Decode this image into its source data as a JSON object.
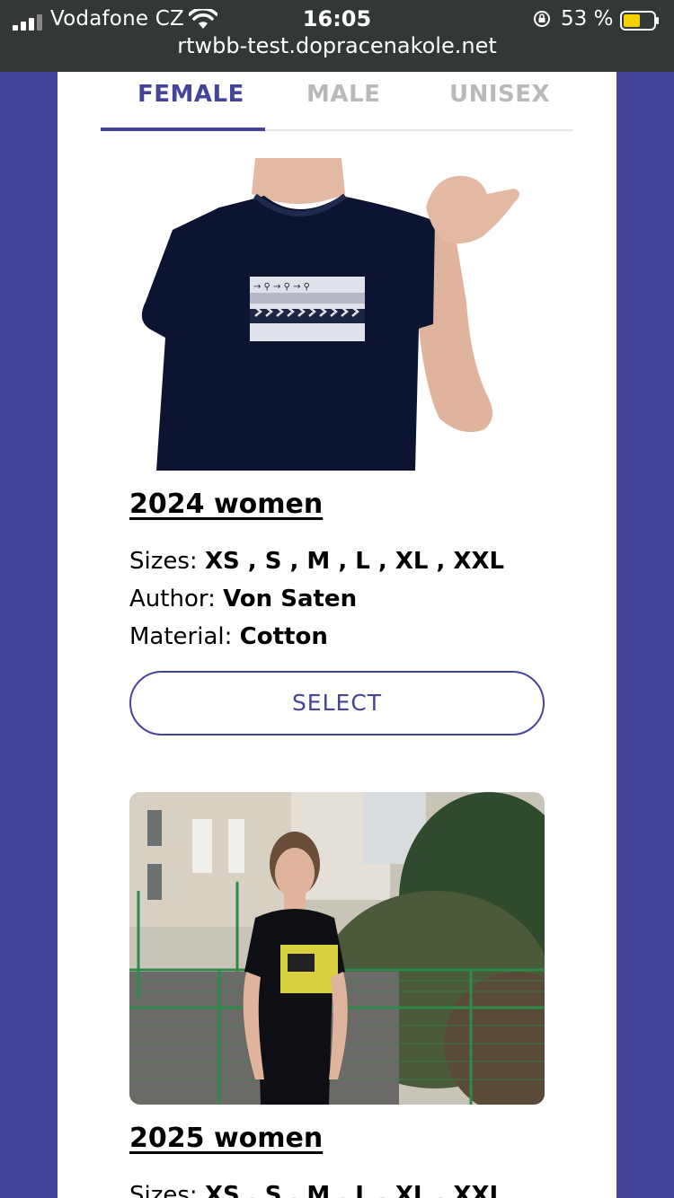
{
  "status_bar": {
    "carrier": "Vodafone CZ",
    "time": "16:05",
    "battery": "53 %",
    "url": "rtwbb-test.dopracenakole.net",
    "icons": [
      "signal-icon",
      "wifi-icon",
      "orientation-lock-icon",
      "battery-icon"
    ]
  },
  "tabs": [
    {
      "label": "FEMALE",
      "active": true
    },
    {
      "label": "MALE",
      "active": false
    },
    {
      "label": "UNISEX",
      "active": false
    }
  ],
  "products": [
    {
      "title": "2024 women",
      "sizes_label": "Sizes:",
      "sizes": "XS , S , M , L , XL , XXL",
      "author_label": "Author:",
      "author": "Von Saten",
      "material_label": "Material:",
      "material": "Cotton",
      "button": "SELECT"
    },
    {
      "title": "2025 women",
      "sizes_label": "Sizes:",
      "sizes": "XS , S , M , L , XL , XXL"
    }
  ],
  "colors": {
    "accent": "#45449b",
    "background": "#45449b",
    "statusbar": "#333738"
  }
}
